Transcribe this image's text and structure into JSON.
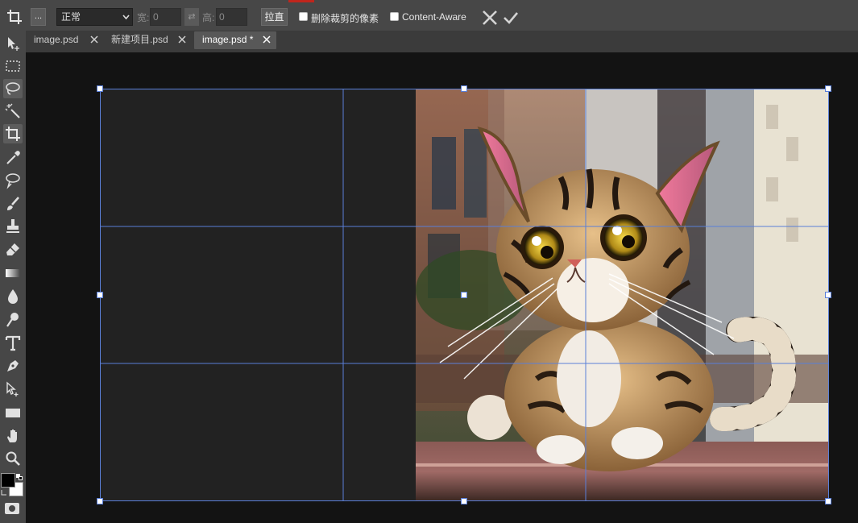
{
  "options_bar": {
    "more_label": "...",
    "ratio_value": "正常",
    "width_label": "宽:",
    "width_value": "0",
    "swap_label": "⇄",
    "height_label": "高:",
    "height_value": "0",
    "straighten_label": "拉直",
    "delete_cropped_label": "删除裁剪的像素",
    "delete_cropped_checked": false,
    "content_aware_label": "Content-Aware",
    "content_aware_checked": false
  },
  "tabs": [
    {
      "label": "image.psd",
      "active": false
    },
    {
      "label": "新建项目.psd",
      "active": false
    },
    {
      "label": "image.psd *",
      "active": true
    }
  ],
  "tools": [
    {
      "name": "move-tool-icon"
    },
    {
      "name": "marquee-tool-icon"
    },
    {
      "name": "lasso-tool-icon"
    },
    {
      "name": "magic-wand-tool-icon"
    },
    {
      "name": "crop-tool-icon"
    },
    {
      "name": "eyedropper-tool-icon"
    },
    {
      "name": "healing-tool-icon"
    },
    {
      "name": "brush-tool-icon"
    },
    {
      "name": "stamp-tool-icon"
    },
    {
      "name": "eraser-tool-icon"
    },
    {
      "name": "gradient-tool-icon"
    },
    {
      "name": "blur-tool-icon"
    },
    {
      "name": "dodge-tool-icon"
    },
    {
      "name": "type-tool-icon"
    },
    {
      "name": "pen-tool-icon"
    },
    {
      "name": "path-select-tool-icon"
    },
    {
      "name": "shape-tool-icon"
    },
    {
      "name": "hand-tool-icon"
    },
    {
      "name": "zoom-tool-icon"
    }
  ],
  "colors": {
    "foreground": "#000000",
    "background": "#ffffff",
    "accent": "#5a7fd8",
    "active_tool": "crop-tool-icon"
  }
}
